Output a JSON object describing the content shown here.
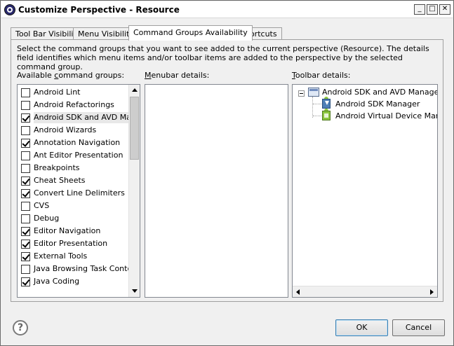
{
  "window": {
    "title": "Customize Perspective - Resource",
    "minimize_label": "_",
    "maximize_label": "□",
    "close_label": "✕"
  },
  "tabs": [
    {
      "label": "Tool Bar Visibility"
    },
    {
      "label": "Menu Visibility"
    },
    {
      "label": "Command Groups Availability"
    },
    {
      "label": "Shortcuts"
    }
  ],
  "active_tab": "Command Groups Availability",
  "description": "Select the command groups that you want to see added to the current perspective (Resource).  The details field identifies which menu items and/or toolbar items are added to the perspective by the selected command group.",
  "columns": {
    "groups_label_mnemonic": "c",
    "groups_label_prefix": "Available ",
    "groups_label_suffix": "ommand groups:",
    "menubar_label_mnemonic": "M",
    "menubar_label_rest": "enubar details:",
    "toolbar_label_mnemonic": "T",
    "toolbar_label_rest": "oolbar details:"
  },
  "command_groups": [
    {
      "label": "Android Lint",
      "checked": false
    },
    {
      "label": "Android Refactorings",
      "checked": false
    },
    {
      "label": "Android SDK and AVD Manager",
      "checked": true,
      "selected": true
    },
    {
      "label": "Android Wizards",
      "checked": false
    },
    {
      "label": "Annotation Navigation",
      "checked": true
    },
    {
      "label": "Ant Editor Presentation",
      "checked": false
    },
    {
      "label": "Breakpoints",
      "checked": false
    },
    {
      "label": "Cheat Sheets",
      "checked": true
    },
    {
      "label": "Convert Line Delimiters",
      "checked": true
    },
    {
      "label": "CVS",
      "checked": false
    },
    {
      "label": "Debug",
      "checked": false
    },
    {
      "label": "Editor Navigation",
      "checked": true
    },
    {
      "label": "Editor Presentation",
      "checked": true
    },
    {
      "label": "External Tools",
      "checked": true
    },
    {
      "label": "Java Browsing Task Context",
      "checked": false
    },
    {
      "label": "Java Coding",
      "checked": true
    }
  ],
  "toolbar_tree": {
    "root": "Android SDK and AVD Manager",
    "children": [
      "Android SDK Manager",
      "Android Virtual Device Manager"
    ]
  },
  "buttons": {
    "help": "?",
    "ok": "OK",
    "cancel": "Cancel"
  }
}
